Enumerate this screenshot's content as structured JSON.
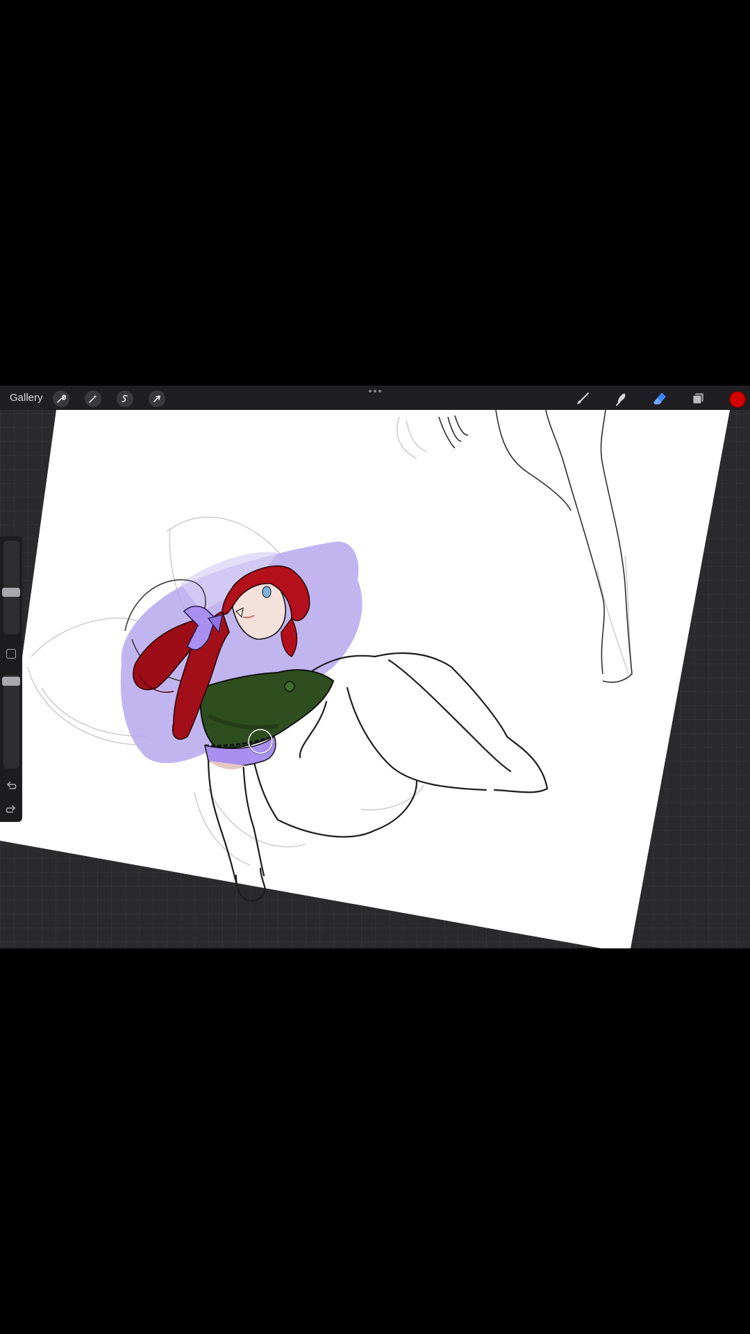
{
  "toolbar": {
    "gallery_label": "Gallery",
    "left_tools": [
      "wrench-icon",
      "magic-wand-icon",
      "selection-icon",
      "transform-arrow-icon"
    ],
    "more_icon": "ellipsis-icon",
    "right_tools": [
      "brush-icon",
      "smudge-icon",
      "eraser-icon",
      "layers-icon"
    ],
    "active_tool": "eraser",
    "active_color": "#d40000"
  },
  "sidebar": {
    "brush_size_icon": "size-slider",
    "modify_icon": "square-icon",
    "opacity_icon": "opacity-slider",
    "undo_icon": "undo-icon",
    "redo_icon": "redo-icon"
  },
  "colors": {
    "accent_blue": "#3a86ff",
    "hair_red": "#b3101b",
    "cape_green": "#2f4e1f",
    "ribbon_purple": "#a98ff0",
    "background_wash": "#b5a8ec"
  }
}
